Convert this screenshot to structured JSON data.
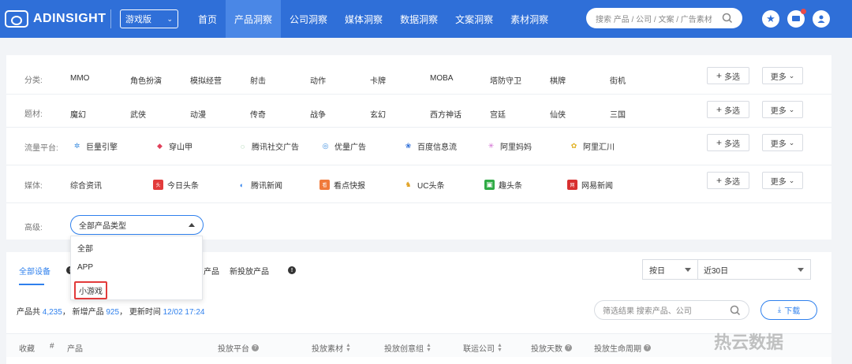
{
  "brand": {
    "name": "ADINSIGHT"
  },
  "version_select": {
    "value": "游戏版"
  },
  "nav": {
    "items": [
      {
        "label": "首页"
      },
      {
        "label": "产品洞察",
        "active": true
      },
      {
        "label": "公司洞察"
      },
      {
        "label": "媒体洞察"
      },
      {
        "label": "数据洞察"
      },
      {
        "label": "文案洞察"
      },
      {
        "label": "素材洞察"
      }
    ]
  },
  "search": {
    "placeholder": "搜索 产品 / 公司 / 文案 / 广告素材"
  },
  "filters": {
    "category": {
      "label": "分类:",
      "items": [
        "MMO",
        "角色扮演",
        "模拟经营",
        "射击",
        "动作",
        "卡牌",
        "MOBA",
        "塔防守卫",
        "棋牌",
        "街机"
      ]
    },
    "theme": {
      "label": "题材:",
      "items": [
        "魔幻",
        "武侠",
        "动漫",
        "传奇",
        "战争",
        "玄幻",
        "西方神话",
        "宫廷",
        "仙侠",
        "三国"
      ]
    },
    "traffic": {
      "label": "流量平台:",
      "items": [
        "巨量引擎",
        "穿山甲",
        "腾讯社交广告",
        "优量广告",
        "百度信息流",
        "阿里妈妈",
        "阿里汇川"
      ]
    },
    "media": {
      "label": "媒体:",
      "items": [
        "综合资讯",
        "今日头条",
        "腾讯新闻",
        "看点快报",
        "UC头条",
        "趣头条",
        "网易新闻"
      ]
    },
    "advanced": {
      "label": "高级:",
      "select_value": "全部产品类型"
    },
    "multi_label": "多选",
    "more_label": "更多"
  },
  "dropdown": {
    "options": [
      "全部",
      "APP",
      "小游戏"
    ],
    "selected": "小游戏"
  },
  "tabs": {
    "items": [
      "全部设备",
      "产品",
      "新投放产品"
    ]
  },
  "period": {
    "unit": "按日",
    "range": "近30日"
  },
  "stats": {
    "prefix": "产品共",
    "total": "4,235",
    "new_label": "新增产品",
    "new_count": "925",
    "updated_label": "更新时间",
    "updated_time": "12/02 17:24"
  },
  "filter_search": {
    "placeholder": "筛选结果 搜索产品、公司"
  },
  "download_label": "下载",
  "table": {
    "headers": [
      "收藏",
      "#",
      "产品",
      "投放平台",
      "投放素材",
      "投放创意组",
      "联运公司",
      "投放天数",
      "投放生命周期"
    ]
  },
  "watermark": "热云数据",
  "colors": {
    "nav_bg": "#2f6fd8",
    "accent": "#2f80ed",
    "highlight": "#e23b3b"
  }
}
